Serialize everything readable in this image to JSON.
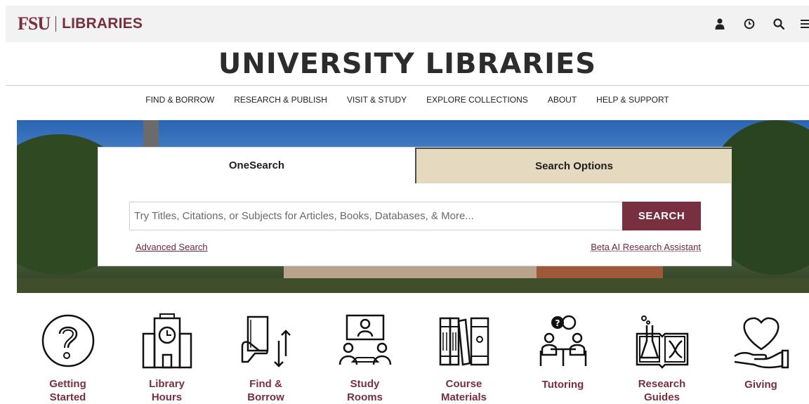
{
  "header": {
    "logo_fsu": "FSU",
    "logo_libraries": "LIBRARIES",
    "icons": [
      "user-icon",
      "clock-icon",
      "search-icon",
      "menu-icon"
    ]
  },
  "site_title": "UNIVERSITY LIBRARIES",
  "nav": {
    "items": [
      {
        "label": "FIND & BORROW"
      },
      {
        "label": "RESEARCH & PUBLISH"
      },
      {
        "label": "VISIT & STUDY"
      },
      {
        "label": "EXPLORE COLLECTIONS"
      },
      {
        "label": "ABOUT"
      },
      {
        "label": "HELP & SUPPORT"
      }
    ]
  },
  "search": {
    "tab_onesearch": "OneSearch",
    "tab_options": "Search Options",
    "placeholder": "Try Titles, Citations, or Subjects for Articles, Books, Databases, & More...",
    "value": "",
    "button": "SEARCH",
    "advanced_link": "Advanced Search",
    "ai_link": "Beta AI Research Assistant"
  },
  "quick_links": [
    {
      "label": "Getting\nStarted",
      "icon": "question-icon"
    },
    {
      "label": "Library\nHours",
      "icon": "library-clock-icon"
    },
    {
      "label": "Find &\nBorrow",
      "icon": "book-exchange-icon"
    },
    {
      "label": "Study\nRooms",
      "icon": "study-room-icon"
    },
    {
      "label": "Course\nMaterials",
      "icon": "books-icon"
    },
    {
      "label": "Tutoring",
      "icon": "tutoring-icon"
    },
    {
      "label": "Research\nGuides",
      "icon": "research-guide-icon"
    },
    {
      "label": "Giving",
      "icon": "heart-hand-icon"
    }
  ],
  "colors": {
    "brand_garnet": "#782f40",
    "gold_tab": "#e5d9bf",
    "topbar": "#f2f2f2"
  }
}
